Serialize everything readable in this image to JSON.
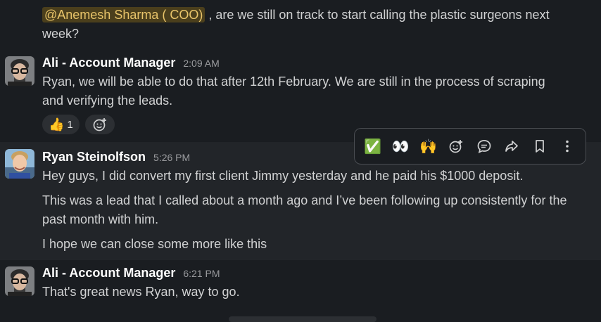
{
  "messages": [
    {
      "mention": "@Anemesh Sharma ( COO)",
      "text_after_mention": " , are we still on track to start calling the plastic surgeons next",
      "text_line2": "week?"
    },
    {
      "sender": "Ali - Account Manager",
      "time": "2:09 AM",
      "line1": "Ryan, we will be able to do that after 12th February. We are still in the process of scraping",
      "line2": "and verifying the leads.",
      "reactions": [
        {
          "emoji": "👍",
          "count": "1"
        }
      ]
    },
    {
      "sender": "Ryan Steinolfson",
      "time": "5:26 PM",
      "para1": "Hey guys, I did convert my first client Jimmy yesterday and he paid his $1000 deposit.",
      "para2_line1": "This was a lead that I called about a month ago and I’ve been following up consistently for the",
      "para2_line2": "past month with him.",
      "para3": "I hope we can close some more like this"
    },
    {
      "sender": "Ali - Account Manager",
      "time": "6:21 PM",
      "text": "That's great news Ryan, way to go."
    }
  ],
  "toolbar": {
    "items": [
      {
        "emoji": "✅",
        "icon": "check-mark-emoji"
      },
      {
        "emoji": "👀",
        "icon": "eyes-emoji"
      },
      {
        "emoji": "🙌",
        "icon": "raised-hands-emoji"
      },
      {
        "icon": "add-reaction-icon"
      },
      {
        "icon": "reply-thread-icon"
      },
      {
        "icon": "share-forward-icon"
      },
      {
        "icon": "bookmark-icon"
      },
      {
        "icon": "more-actions-icon"
      }
    ]
  },
  "colors": {
    "background": "#1a1d21",
    "hover_background": "#222529",
    "mention_bg": "#4b3f1c",
    "mention_text": "#e8c46a"
  }
}
